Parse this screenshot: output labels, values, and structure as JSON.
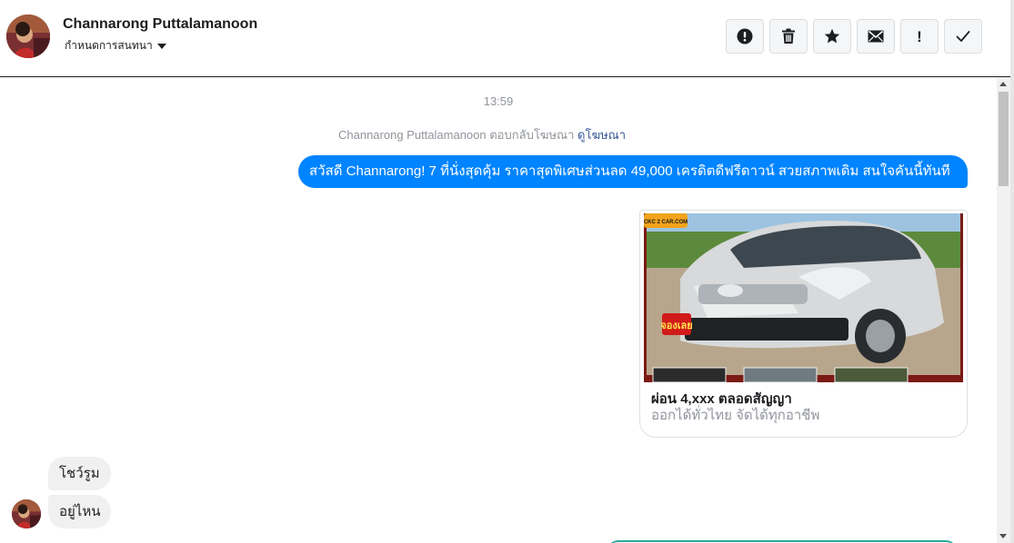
{
  "header": {
    "contact_name": "Channarong Puttalamanoon",
    "conversation_settings_label": "กำหนดการสนทนา",
    "actions": [
      {
        "name": "report-button",
        "icon": "alert-circle-icon"
      },
      {
        "name": "delete-button",
        "icon": "trash-icon"
      },
      {
        "name": "star-button",
        "icon": "star-icon"
      },
      {
        "name": "mark-unread-button",
        "icon": "envelope-icon"
      },
      {
        "name": "mark-important-button",
        "icon": "exclamation-icon",
        "glyph": "!"
      },
      {
        "name": "mark-done-button",
        "icon": "check-icon"
      }
    ]
  },
  "thread": {
    "timestamp": "13:59",
    "reply_note": {
      "text": "Channarong Puttalamanoon ตอบกลับโฆษณา",
      "link_label": "ดูโฆษณา"
    },
    "outgoing_message": "สวัสดี Channarong! 7 ที่นั่งสุดคุ้ม ราคาสุดพิเศษส่วนลด 49,000 เครดิตดีฟรีดาวน์ สวยสภาพเดิม สนใจคันนี้ทันที",
    "ad_card": {
      "image_icon": "car-ad-photo",
      "watermark": "CKC 2 CAR.COM",
      "stamp": "จองเลย",
      "title": "ผ่อน 4,xxx ตลอดสัญญา",
      "subtitle": "ออกได้ทั่วไทย จัดได้ทุกอาชีพ"
    },
    "incoming_messages": [
      {
        "text": "โชว์รูม"
      },
      {
        "text": "อยู่ไหน"
      }
    ]
  },
  "colors": {
    "outgoing_bubble": "#0084ff",
    "incoming_bubble": "#f1f0f0",
    "link": "#365899",
    "meta_text": "#90949c"
  }
}
